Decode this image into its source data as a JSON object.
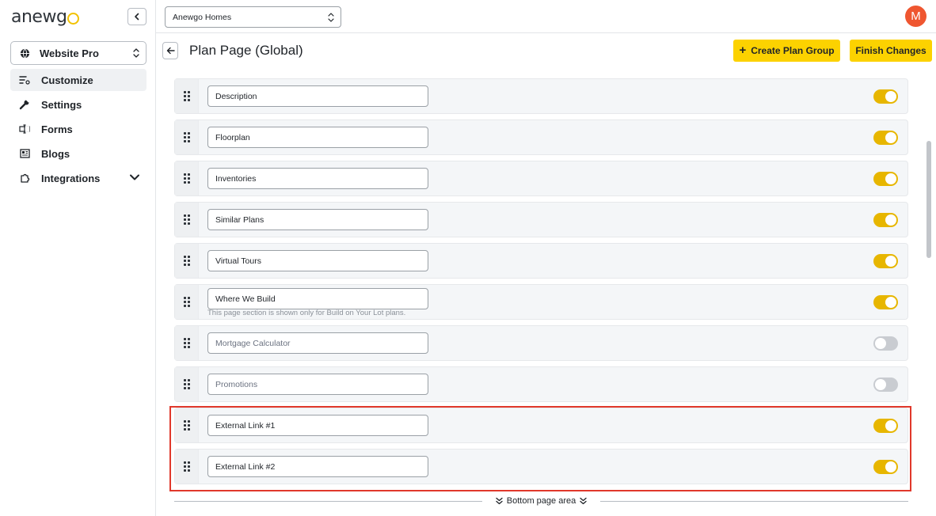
{
  "app": {
    "logo": "anewgo"
  },
  "sidebar": {
    "site_select": "Website Pro",
    "items": [
      {
        "label": "Customize",
        "icon": "customize-icon",
        "active": true
      },
      {
        "label": "Settings",
        "icon": "wrench-icon"
      },
      {
        "label": "Forms",
        "icon": "form-icon"
      },
      {
        "label": "Blogs",
        "icon": "newspaper-icon"
      },
      {
        "label": "Integrations",
        "icon": "puzzle-icon"
      }
    ]
  },
  "topbar": {
    "builder": "Anewgo Homes",
    "avatar_initial": "M"
  },
  "header": {
    "title": "Plan Page (Global)",
    "create_button": "Create Plan Group",
    "finish_button": "Finish Changes"
  },
  "sections": [
    {
      "name": "Description",
      "enabled": true
    },
    {
      "name": "Floorplan",
      "enabled": true
    },
    {
      "name": "Inventories",
      "enabled": true
    },
    {
      "name": "Similar Plans",
      "enabled": true
    },
    {
      "name": "Virtual Tours",
      "enabled": true
    },
    {
      "name": "Where We Build",
      "enabled": true,
      "hint": "This page section is shown only for Build on Your Lot plans."
    },
    {
      "name": "Mortgage Calculator",
      "enabled": false
    },
    {
      "name": "Promotions",
      "enabled": false
    },
    {
      "name": "External Link #1",
      "enabled": true
    },
    {
      "name": "External Link #2",
      "enabled": true
    }
  ],
  "footer": {
    "divider_label": "Bottom page area"
  },
  "colors": {
    "accent": "#fcd200",
    "toggle_on": "#e7b600",
    "toggle_off": "#c9ccd1",
    "highlight": "#e0382b",
    "avatar": "#ef5630"
  }
}
